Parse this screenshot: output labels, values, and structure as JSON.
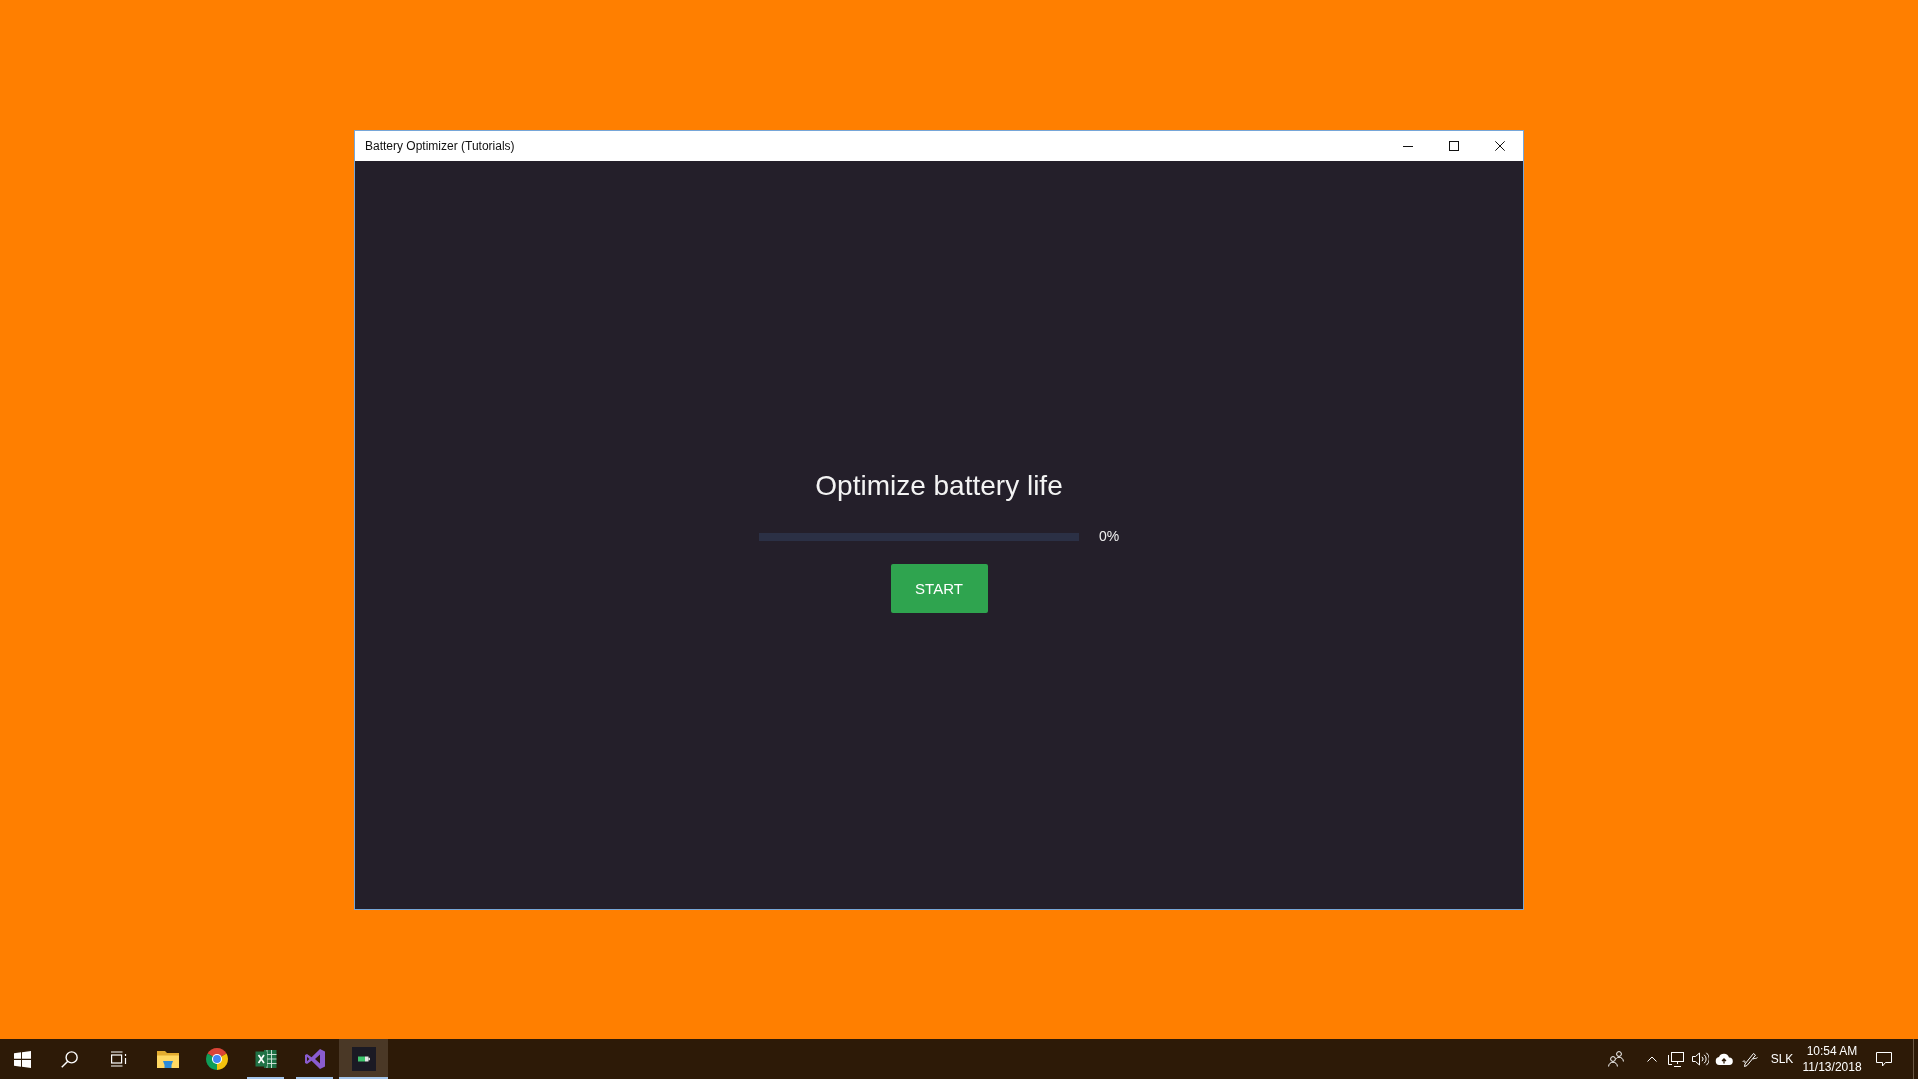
{
  "window": {
    "title": "Battery Optimizer (Tutorials)"
  },
  "content": {
    "heading": "Optimize battery life",
    "progress": {
      "level": 0,
      "reading": "0%"
    },
    "button": "START"
  },
  "taskbar": {
    "buttons": [
      {
        "kind": "start"
      },
      {
        "kind": "search"
      },
      {
        "kind": "task_view"
      }
    ],
    "apps": [
      {
        "kind": "file_explorer",
        "running": false,
        "selected": false
      },
      {
        "kind": "browser",
        "running": false,
        "selected": false
      },
      {
        "kind": "spreadsheet",
        "running": true,
        "selected": false
      },
      {
        "kind": "code_editor",
        "running": true,
        "selected": false
      },
      {
        "kind": "battery_app",
        "running": true,
        "selected": true
      }
    ],
    "tray_icons": [
      {
        "kind": "people"
      },
      {
        "kind": "chevron"
      },
      {
        "kind": "network"
      },
      {
        "kind": "volume"
      },
      {
        "kind": "cloud"
      },
      {
        "kind": "pen"
      }
    ],
    "language": "SLK",
    "time": "10:54 AM",
    "date": "11/13/2018"
  }
}
